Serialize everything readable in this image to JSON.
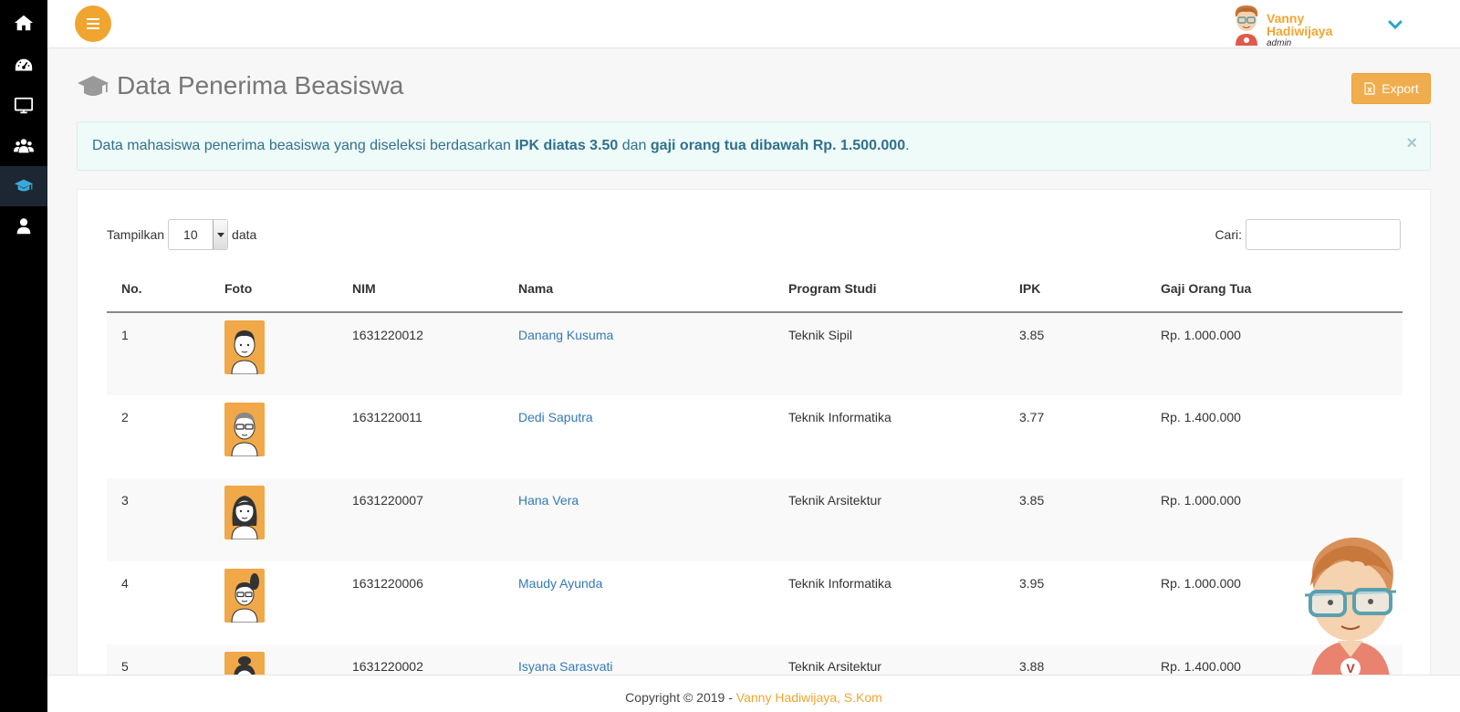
{
  "sidebar": {
    "items": [
      {
        "icon": "home-icon",
        "active": false
      },
      {
        "icon": "dashboard-icon",
        "active": false
      },
      {
        "icon": "monitor-icon",
        "active": false
      },
      {
        "icon": "users-icon",
        "active": false
      },
      {
        "icon": "graduation-cap-icon",
        "active": true
      },
      {
        "icon": "user-icon",
        "active": false
      }
    ]
  },
  "topbar": {
    "menu_icon": "hamburger-icon",
    "user": {
      "name": "Vanny Hadiwijaya",
      "role": "admin"
    }
  },
  "page": {
    "title": "Data Penerima Beasiswa",
    "title_icon": "graduation-cap-icon",
    "export_label": "Export",
    "export_icon": "excel-file-icon"
  },
  "alert": {
    "prefix": "Data mahasiswa penerima beasiswa yang diseleksi berdasarkan ",
    "criteria1": "IPK diatas 3.50",
    "middle": " dan ",
    "criteria2": "gaji orang tua dibawah Rp. 1.500.000",
    "suffix": ".",
    "close": "×"
  },
  "table_controls": {
    "show_label": "Tampilkan",
    "show_value": "10",
    "show_suffix": "data",
    "search_label": "Cari:",
    "search_value": ""
  },
  "table": {
    "columns": [
      "No.",
      "Foto",
      "NIM",
      "Nama",
      "Program Studi",
      "IPK",
      "Gaji Orang Tua"
    ],
    "rows": [
      {
        "no": "1",
        "nim": "1631220012",
        "nama": "Danang Kusuma",
        "prodi": "Teknik Sipil",
        "ipk": "3.85",
        "gaji": "Rp. 1.000.000"
      },
      {
        "no": "2",
        "nim": "1631220011",
        "nama": "Dedi Saputra",
        "prodi": "Teknik Informatika",
        "ipk": "3.77",
        "gaji": "Rp. 1.400.000"
      },
      {
        "no": "3",
        "nim": "1631220007",
        "nama": "Hana Vera",
        "prodi": "Teknik Arsitektur",
        "ipk": "3.85",
        "gaji": "Rp. 1.000.000"
      },
      {
        "no": "4",
        "nim": "1631220006",
        "nama": "Maudy Ayunda",
        "prodi": "Teknik Informatika",
        "ipk": "3.95",
        "gaji": "Rp. 1.000.000"
      },
      {
        "no": "5",
        "nim": "1631220002",
        "nama": "Isyana Sarasvati",
        "prodi": "Teknik Arsitektur",
        "ipk": "3.88",
        "gaji": "Rp. 1.400.000"
      }
    ]
  },
  "footer": {
    "text": "Copyright © 2019 - ",
    "link": "Vanny Hadiwijaya, S.Kom"
  },
  "colors": {
    "accent": "#f0a530",
    "link": "#337ab7",
    "sidebar_bg": "#000000",
    "alert_text": "#31708f"
  }
}
